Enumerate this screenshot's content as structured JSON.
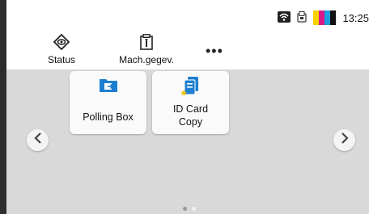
{
  "status_bar": {
    "clock": "13:25",
    "wifi_icon": "wifi-icon",
    "card_icon": "card-reader-icon",
    "toner_colors": [
      "#f5d200",
      "#d81b8a",
      "#1aa0e0",
      "#111111"
    ]
  },
  "shortcuts": [
    {
      "label": "Status",
      "icon": "eye-diamond-icon"
    },
    {
      "label": "Mach.gegev.",
      "icon": "info-device-icon"
    }
  ],
  "more_label": "•••",
  "tiles": [
    {
      "label": "Polling Box",
      "icon": "polling-box-icon"
    },
    {
      "label_line1": "ID Card",
      "label_line2": "Copy",
      "icon": "id-card-copy-icon"
    }
  ],
  "pager": {
    "current": 1,
    "total": 2
  },
  "colors": {
    "accent": "#1e7fd0",
    "panel": "#d9d9d9",
    "tile": "#fafafa"
  }
}
